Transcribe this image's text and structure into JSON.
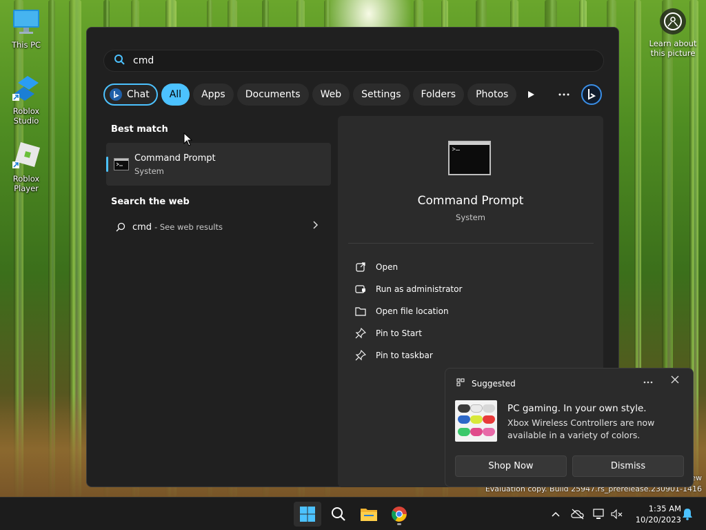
{
  "desktop": {
    "icons": [
      {
        "label": "This PC"
      },
      {
        "label": "Roblox Studio"
      },
      {
        "label": "Roblox Player"
      }
    ],
    "learn_about": "Learn about this picture",
    "watermark_line1": "ew",
    "watermark_line2": "Evaluation copy. Build 25947.rs_prerelease.230901-1416"
  },
  "search": {
    "query": "cmd",
    "filters": [
      {
        "label": "Chat",
        "state": "bing-chat"
      },
      {
        "label": "All",
        "state": "selected"
      },
      {
        "label": "Apps"
      },
      {
        "label": "Documents"
      },
      {
        "label": "Web"
      },
      {
        "label": "Settings"
      },
      {
        "label": "Folders"
      },
      {
        "label": "Photos"
      }
    ],
    "best_match_title": "Best match",
    "best_match": {
      "name": "Command Prompt",
      "type": "System"
    },
    "web_title": "Search the web",
    "web_result": {
      "query": "cmd",
      "suffix": "- See web results"
    }
  },
  "details": {
    "name": "Command Prompt",
    "type": "System",
    "actions": [
      {
        "label": "Open",
        "icon": "open-external-icon"
      },
      {
        "label": "Run as administrator",
        "icon": "admin-shield-icon"
      },
      {
        "label": "Open file location",
        "icon": "folder-icon"
      },
      {
        "label": "Pin to Start",
        "icon": "pin-icon"
      },
      {
        "label": "Pin to taskbar",
        "icon": "pin-icon"
      }
    ]
  },
  "toast": {
    "header": "Suggested",
    "title": "PC gaming. In your own style.",
    "body": "Xbox Wireless Controllers are now available in a variety of colors.",
    "primary_button": "Shop Now",
    "secondary_button": "Dismiss"
  },
  "taskbar": {
    "time": "1:35 AM",
    "date": "10/20/2023"
  },
  "colors": {
    "accent": "#4cc2ff",
    "panel_bg": "#202020",
    "taskbar_bg": "#1c1c1c"
  }
}
